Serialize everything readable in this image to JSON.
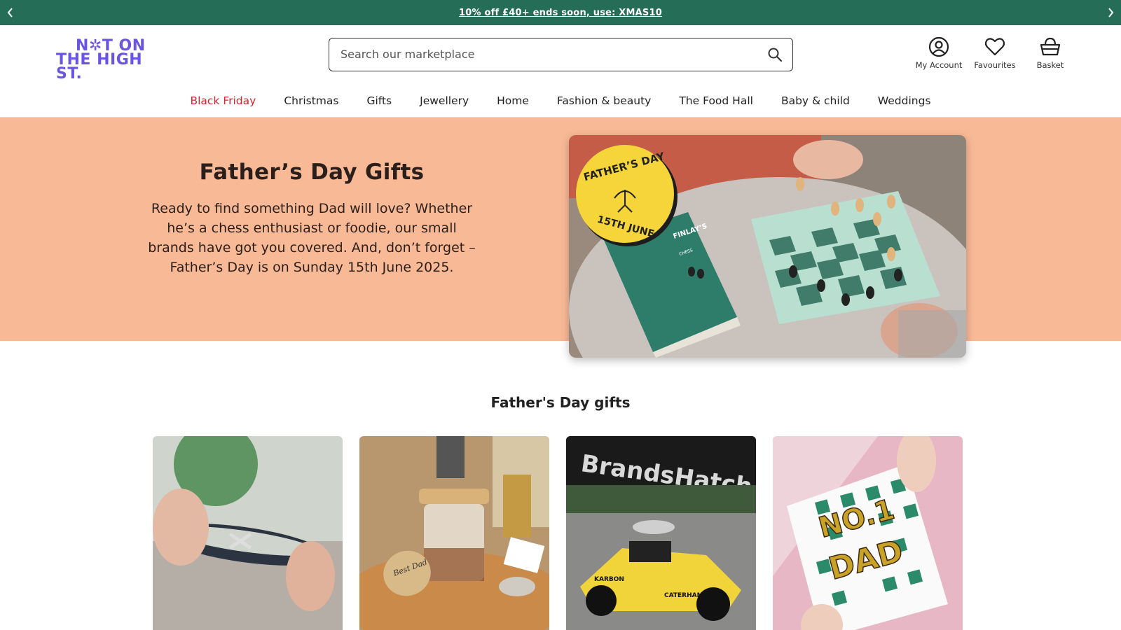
{
  "promo": {
    "text": "10% off £40+ ends soon, use: XMAS10",
    "prev_icon": "chevron-left-icon",
    "next_icon": "chevron-right-icon"
  },
  "header": {
    "logo_line1": "N✲T ON",
    "logo_line2": "THE HIGH ST.",
    "search_placeholder": "Search our marketplace",
    "account_label": "My Account",
    "favourites_label": "Favourites",
    "basket_label": "Basket"
  },
  "nav": {
    "items": [
      "Black Friday",
      "Christmas",
      "Gifts",
      "Jewellery",
      "Home",
      "Fashion & beauty",
      "The Food Hall",
      "Baby & child",
      "Weddings"
    ]
  },
  "hero": {
    "title": "Father’s Day Gifts",
    "body": "Ready to find something Dad will love? Whether he’s a chess enthusiast or foodie, our small brands have got you covered. And, don’t forget – Father’s Day is on Sunday 15th June 2025.",
    "badge_top": "FATHER’S DAY",
    "badge_bottom": "15TH JUNE",
    "book_title": "FINLAY’S",
    "book_sub": "CHESS"
  },
  "section": {
    "title": "Father's Day gifts"
  },
  "cards": {
    "c2_tag": "Best Dad",
    "c3_sign": "BrandsHatch",
    "c3_car": "KARBON",
    "c3_car2": "CATERHAM",
    "c4_line1": "NO.1",
    "c4_line2": "DAD"
  },
  "colors": {
    "promo_bg": "#256d57",
    "brand": "#6a55e0",
    "hero_bg": "#f8b996",
    "sale_red": "#d9232d"
  }
}
